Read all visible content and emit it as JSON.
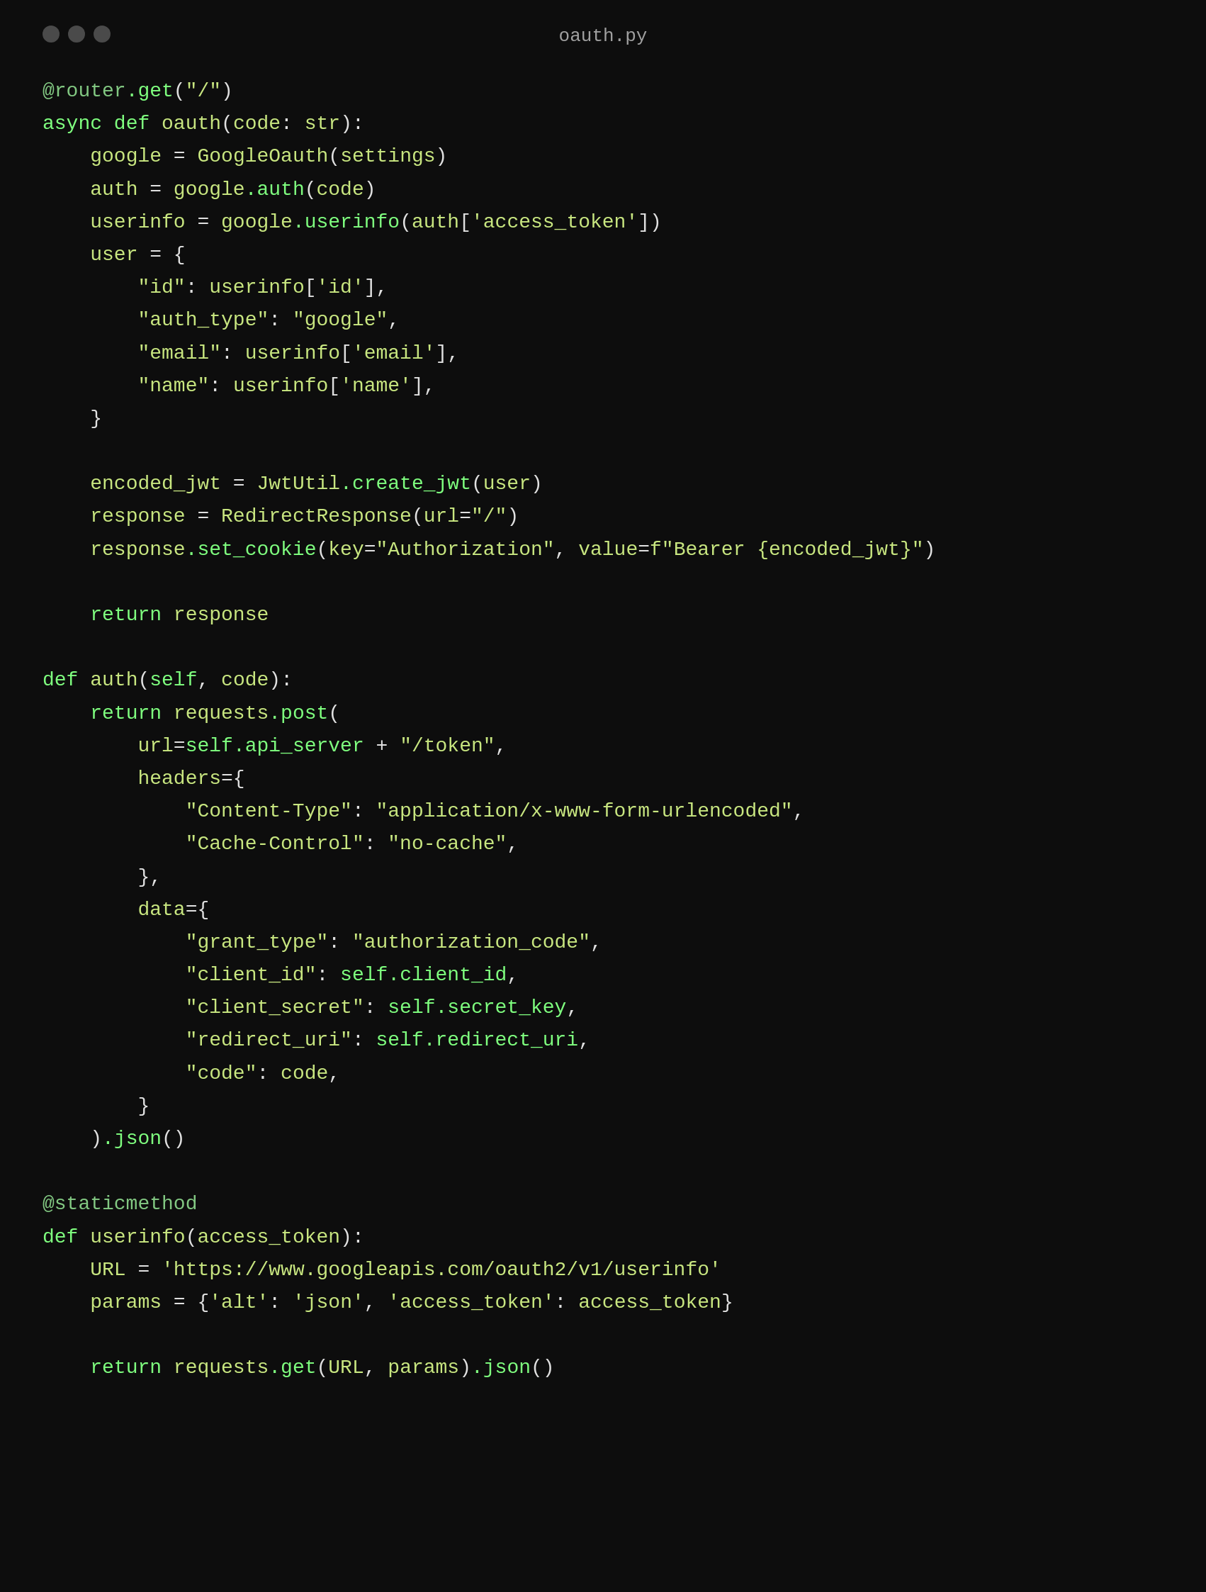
{
  "window": {
    "title": "oauth.py",
    "traffic_lights": [
      "close",
      "minimize",
      "maximize"
    ]
  },
  "code": {
    "filename": "oauth.py",
    "language": "python"
  }
}
